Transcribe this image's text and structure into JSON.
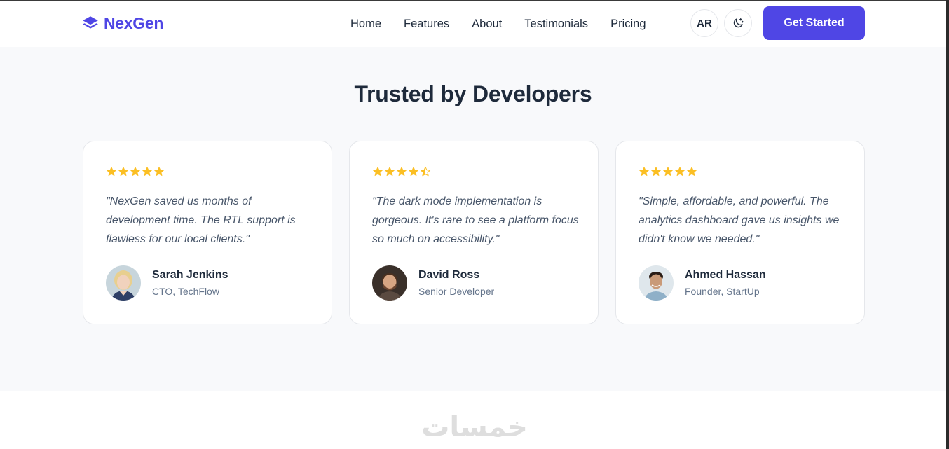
{
  "brand": {
    "name": "NexGen",
    "color": "#4f46e5",
    "icon": "layers-icon"
  },
  "nav": {
    "links": [
      "Home",
      "Features",
      "About",
      "Testimonials",
      "Pricing"
    ],
    "lang_label": "AR",
    "theme_icon": "moon-icon",
    "cta_label": "Get Started"
  },
  "section": {
    "title": "Trusted by Developers",
    "testimonials": [
      {
        "rating": 5,
        "quote": "\"NexGen saved us months of development time. The RTL support is flawless for our local clients.\"",
        "name": "Sarah Jenkins",
        "role": "CTO, TechFlow"
      },
      {
        "rating": 4.5,
        "quote": "\"The dark mode implementation is gorgeous. It's rare to see a platform focus so much on accessibility.\"",
        "name": "David Ross",
        "role": "Senior Developer"
      },
      {
        "rating": 5,
        "quote": "\"Simple, affordable, and powerful. The analytics dashboard gave us insights we didn't know we needed.\"",
        "name": "Ahmed Hassan",
        "role": "Founder, StartUp"
      }
    ]
  },
  "colors": {
    "star": "#fbbf24",
    "accent": "#4f46e5",
    "text": "#1e2a3b",
    "muted": "#64748b"
  },
  "watermark": "خمسات"
}
